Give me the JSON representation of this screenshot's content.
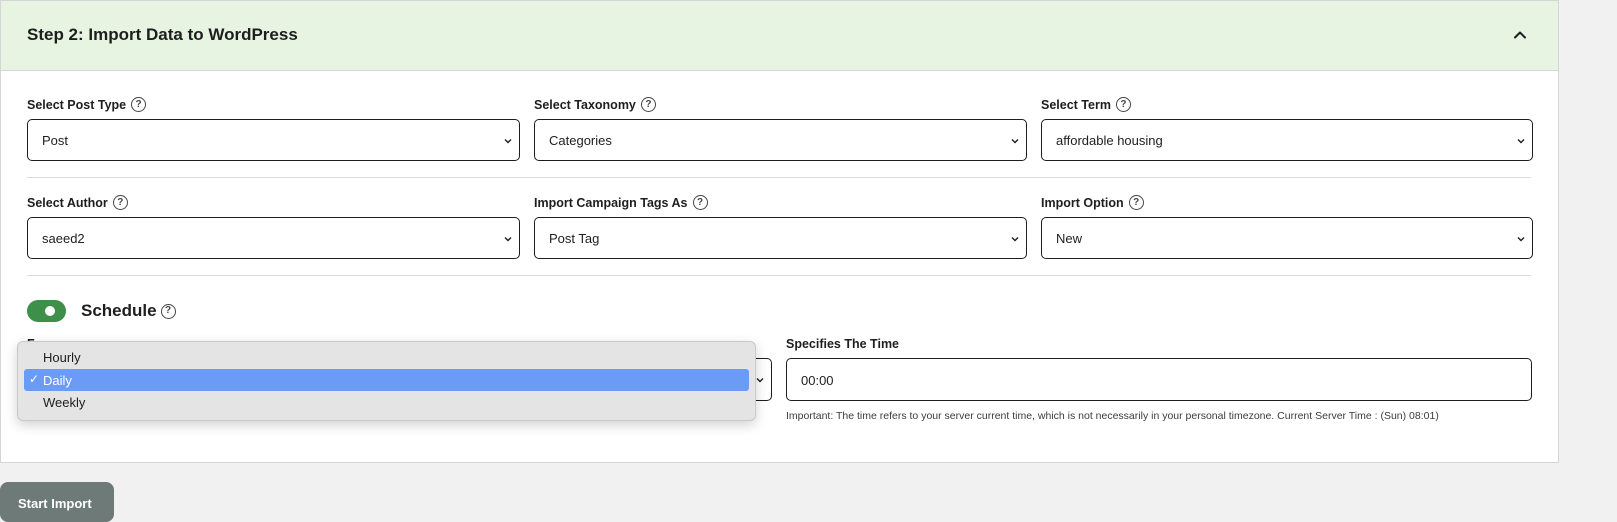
{
  "step": {
    "title": "Step 2: Import Data to WordPress"
  },
  "fields": {
    "post_type": {
      "label": "Select Post Type",
      "value": "Post"
    },
    "taxonomy": {
      "label": "Select Taxonomy",
      "value": "Categories"
    },
    "term": {
      "label": "Select Term",
      "value": "affordable housing"
    },
    "author": {
      "label": "Select Author",
      "value": "saeed2"
    },
    "campaign_tags": {
      "label": "Import Campaign Tags As",
      "value": "Post Tag"
    },
    "import_option": {
      "label": "Import Option",
      "value": "New"
    }
  },
  "schedule": {
    "label": "Schedule",
    "enabled": true,
    "frequency": {
      "label": "Frequency",
      "options": [
        "Hourly",
        "Daily",
        "Weekly"
      ],
      "selected": "Daily",
      "check": "✓"
    },
    "time": {
      "label": "Specifies The Time",
      "value": "00:00",
      "note": "Important: The time refers to your server current time, which is not necessarily in your personal timezone. Current Server Time : (Sun) 08:01)"
    }
  },
  "actions": {
    "start_import": "Start Import"
  },
  "help_glyph": "?",
  "colors": {
    "header_bg": "#e6f4e1",
    "toggle_on": "#3d8f4a",
    "option_highlight": "#6a9cf7",
    "button_bg": "#6d7a78"
  }
}
